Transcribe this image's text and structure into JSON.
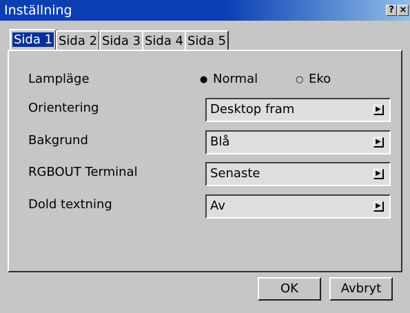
{
  "window": {
    "title": "Inställning",
    "help_glyph": "?",
    "close_glyph": "×"
  },
  "tabs": [
    {
      "label": "Sida 1",
      "active": true
    },
    {
      "label": "Sida 2",
      "active": false
    },
    {
      "label": "Sida 3",
      "active": false
    },
    {
      "label": "Sida 4",
      "active": false
    },
    {
      "label": "Sida 5",
      "active": false
    }
  ],
  "settings": {
    "lamp": {
      "label": "Lampläge",
      "options": [
        {
          "label": "Normal",
          "selected": true
        },
        {
          "label": "Eko",
          "selected": false
        }
      ]
    },
    "orientation": {
      "label": "Orientering",
      "value": "Desktop fram"
    },
    "background": {
      "label": "Bakgrund",
      "value": "Blå"
    },
    "rgbout": {
      "label": "RGBOUT Terminal",
      "value": "Senaste"
    },
    "captions": {
      "label": "Dold textning",
      "value": "Av"
    }
  },
  "buttons": {
    "ok": "OK",
    "cancel": "Avbryt"
  },
  "icons": {
    "radio_selected": "●",
    "radio_unselected": "○",
    "dropdown": "▶"
  }
}
